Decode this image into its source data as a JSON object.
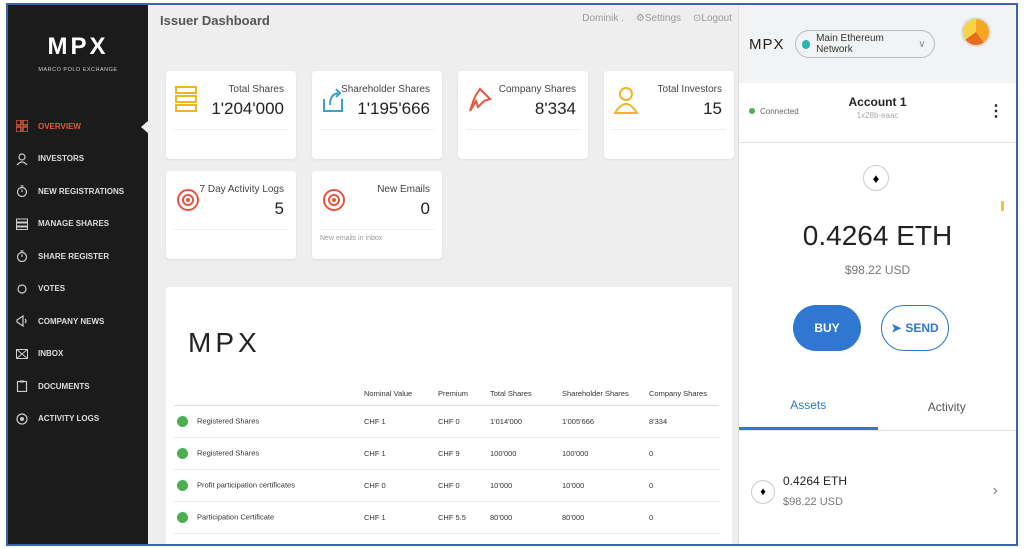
{
  "sidebar": {
    "logo": "MPX",
    "logo_sub": "MARCO POLO EXCHANGE",
    "items": [
      {
        "label": "OVERVIEW",
        "icon": "grid-icon",
        "active": true
      },
      {
        "label": "INVESTORS",
        "icon": "user-icon"
      },
      {
        "label": "NEW REGISTRATIONS",
        "icon": "stopwatch-icon"
      },
      {
        "label": "MANAGE SHARES",
        "icon": "list-icon"
      },
      {
        "label": "SHARE REGISTER",
        "icon": "stopwatch-icon"
      },
      {
        "label": "VOTES",
        "icon": "circle-icon"
      },
      {
        "label": "COMPANY NEWS",
        "icon": "megaphone-icon"
      },
      {
        "label": "INBOX",
        "icon": "envelope-icon"
      },
      {
        "label": "DOCUMENTS",
        "icon": "clipboard-icon"
      },
      {
        "label": "ACTIVITY LOGS",
        "icon": "eye-icon"
      }
    ]
  },
  "topbar": {
    "title": "Issuer Dashboard",
    "user": "Dominik .",
    "settings": "Settings",
    "logout": "Logout"
  },
  "cards": {
    "total_shares": {
      "label": "Total Shares",
      "value": "1'204'000"
    },
    "shareholder_shares": {
      "label": "Shareholder Shares",
      "value": "1'195'666"
    },
    "company_shares": {
      "label": "Company Shares",
      "value": "8'334"
    },
    "total_investors": {
      "label": "Total Investors",
      "value": "15"
    },
    "activity_logs": {
      "label": "7 Day Activity Logs",
      "value": "5"
    },
    "new_emails": {
      "label": "New Emails",
      "value": "0",
      "note": "New emails in inbox"
    }
  },
  "panel": {
    "logo": "MPX",
    "headers": [
      "",
      "Nominal Value",
      "Premium",
      "Total Shares",
      "Shareholder Shares",
      "Company Shares"
    ],
    "rows": [
      [
        "Registered Shares",
        "CHF 1",
        "CHF 0",
        "1'014'000",
        "1'005'666",
        "8'334"
      ],
      [
        "Registered Shares",
        "CHF 1",
        "CHF 9",
        "100'000",
        "100'000",
        "0"
      ],
      [
        "Profit participation certificates",
        "CHF 0",
        "CHF 0",
        "10'000",
        "10'000",
        "0"
      ],
      [
        "Participation Certificate",
        "CHF 1",
        "CHF 5.5",
        "80'000",
        "80'000",
        "0"
      ]
    ]
  },
  "metamask": {
    "logo": "MPX",
    "network": "Main Ethereum Network",
    "status": "Connected",
    "account": "Account 1",
    "address": "1x28b-eaac",
    "balance": "0.4264 ETH",
    "balance_usd": "$98.22 USD",
    "buy": "BUY",
    "send": "SEND",
    "tabs": [
      "Assets",
      "Activity"
    ],
    "asset": {
      "amount": "0.4264 ETH",
      "usd": "$98.22 USD"
    }
  }
}
